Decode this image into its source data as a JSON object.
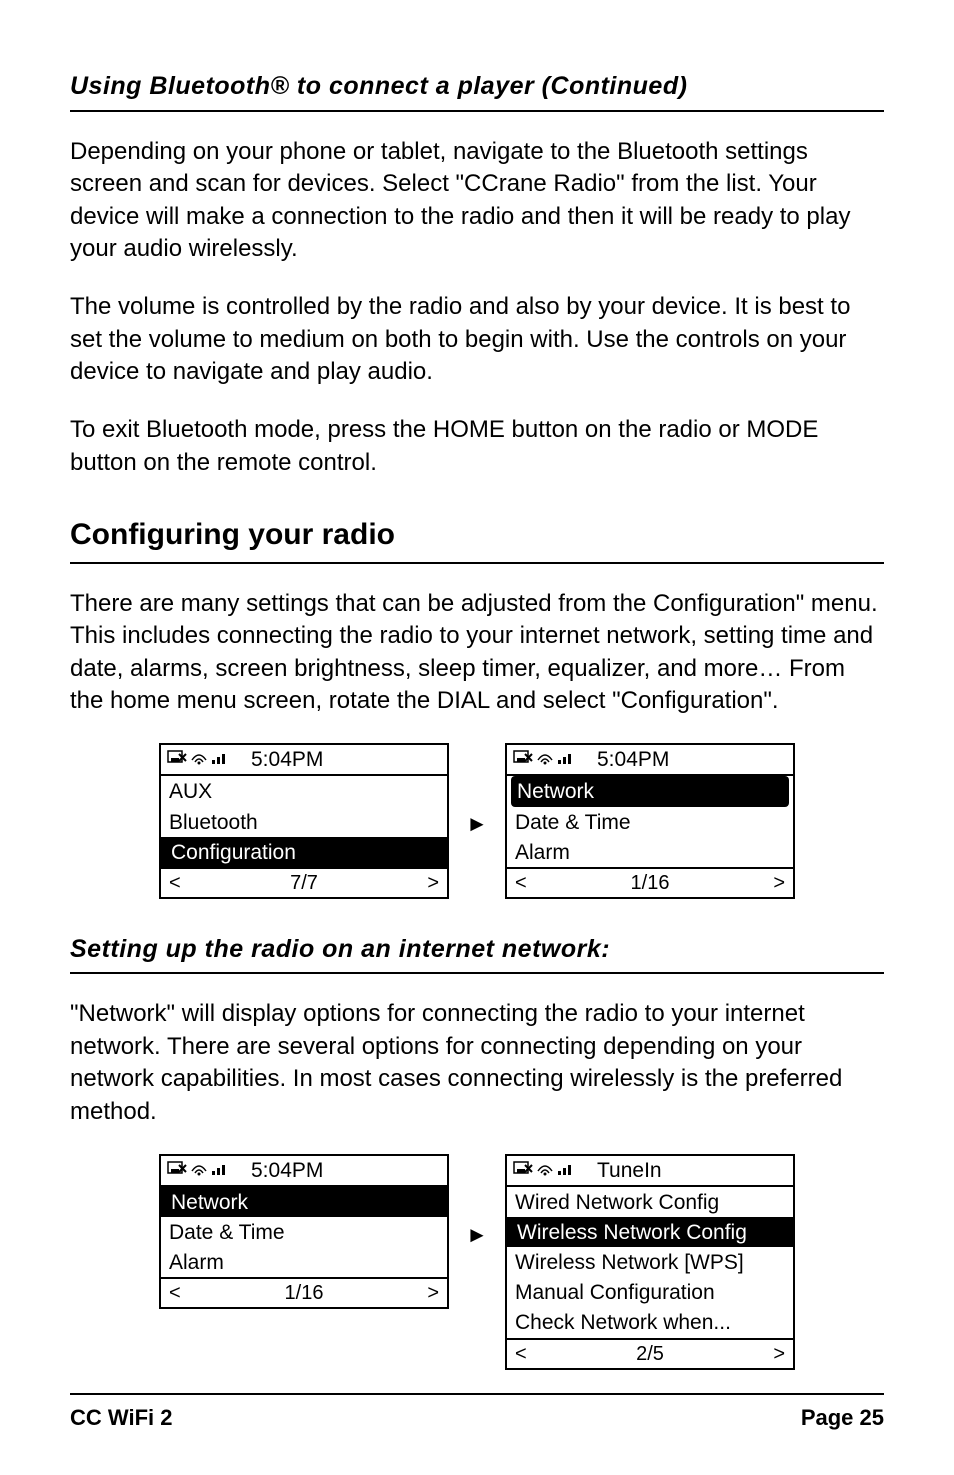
{
  "heading_bt": "Using Bluetooth® to connect a player (Continued)",
  "para_bt1": "Depending on your phone or tablet, navigate to the Bluetooth settings screen and scan for devices. Select \"CCrane Radio\" from the list. Your device will make a connection to the radio and then it will be ready to play your audio wirelessly.",
  "para_bt2": "The volume is controlled by the radio and also by your device. It is best to set the volume to medium on both to begin with. Use the controls on your device to navigate and play audio.",
  "para_bt3": "To exit Bluetooth mode, press the HOME button on the radio or MODE button on the remote control.",
  "heading_cfg": "Configuring your radio",
  "para_cfg1": "There are many settings that can be adjusted from the Configuration\" menu. This includes connecting the radio to your internet network, setting time and date, alarms, screen brightness, sleep timer, equalizer, and more… From the home menu screen, rotate the DIAL and select \"Configuration\".",
  "heading_net": "Setting up the radio on an internet network:",
  "para_net1": "\"Network\" will display options for connecting the radio to your internet network. There are several options for connecting depending on your network capabilities. In most cases connecting wirelessly is the preferred method.",
  "footer_left": "CC WiFi 2",
  "footer_right": "Page 25",
  "arrow_glyph": "►",
  "lcd1_left": {
    "time": "5:04PM",
    "rows": [
      "AUX",
      "Bluetooth",
      "Configuration"
    ],
    "selected_index": 2,
    "footer": {
      "l": "<",
      "c": "7/7",
      "r": ">"
    }
  },
  "lcd1_right": {
    "time": "5:04PM",
    "rows": [
      "Network",
      "Date & Time",
      "Alarm"
    ],
    "selected_index": 0,
    "footer": {
      "l": "<",
      "c": "1/16",
      "r": ">"
    }
  },
  "lcd2_left": {
    "time": "5:04PM",
    "rows": [
      "Network",
      "Date & Time",
      "Alarm"
    ],
    "selected_index": 0,
    "footer": {
      "l": "<",
      "c": "1/16",
      "r": ">"
    }
  },
  "lcd2_right": {
    "time": "TuneIn",
    "rows": [
      "Wired Network Config",
      "Wireless Network Config",
      "Wireless Network [WPS]",
      "Manual Configuration",
      "Check Network when..."
    ],
    "selected_index": 1,
    "footer": {
      "l": "<",
      "c": "2/5",
      "r": ">"
    }
  }
}
